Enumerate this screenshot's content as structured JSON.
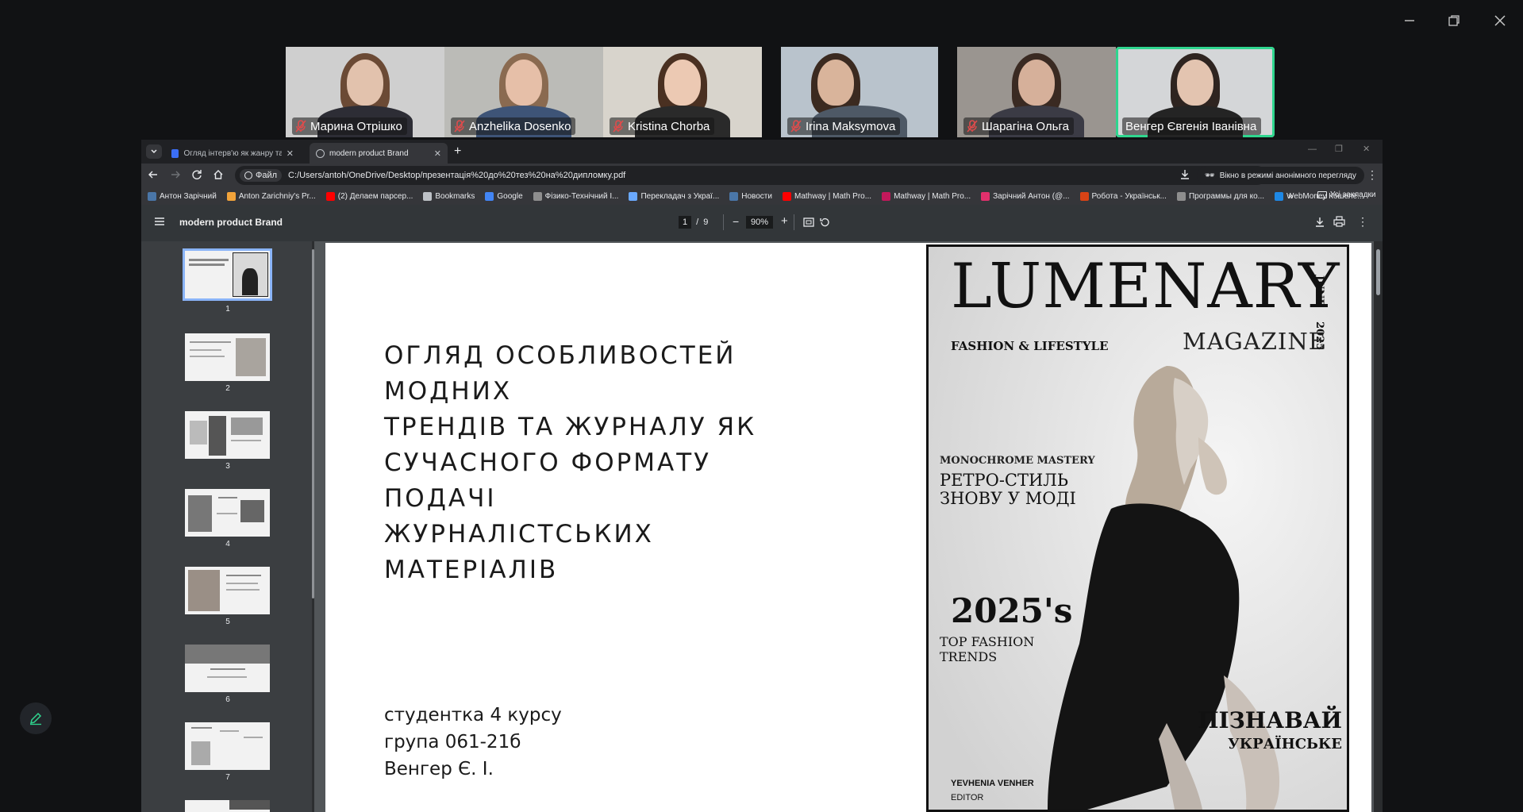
{
  "participants": [
    {
      "name": "Марина Отрішко",
      "muted": true
    },
    {
      "name": "Anzhelika Dosenko",
      "muted": true
    },
    {
      "name": "Kristina Chorba",
      "muted": true
    },
    {
      "name": "Irina Maksymova",
      "muted": true
    },
    {
      "name": "Шарагіна Ольга",
      "muted": true
    },
    {
      "name": "Венгер Євгенія Іванівна",
      "muted": false,
      "active": true
    }
  ],
  "browser": {
    "tabs": [
      {
        "label": "Огляд інтерв'ю як жанру та м..."
      },
      {
        "label": "modern product Brand",
        "active": true
      }
    ],
    "address": {
      "scheme_label": "Файл",
      "url": "C:/Users/antoh/OneDrive/Desktop/презентація%20до%20тез%20на%20дипломку.pdf"
    },
    "incognito_label": "Вікно в режимі анонімного перегляду",
    "bookmarks": [
      {
        "label": "Антон Зарічний",
        "color": "#4a76a8"
      },
      {
        "label": "Anton Zarichniy's Pr...",
        "color": "#f2a33a"
      },
      {
        "label": "(2) Делаем парсер...",
        "color": "#ff0000"
      },
      {
        "label": "Bookmarks",
        "color": "#bdc1c6"
      },
      {
        "label": "Google",
        "color": "#4285f4"
      },
      {
        "label": "Фізико-Технічний І...",
        "color": "#8e8e8e"
      },
      {
        "label": "Перекладач з Украї...",
        "color": "#6aa9ff"
      },
      {
        "label": "Новости",
        "color": "#4a76a8"
      },
      {
        "label": "Mathway | Math Pro...",
        "color": "#ff0000"
      },
      {
        "label": "Mathway | Math Pro...",
        "color": "#c2185b"
      },
      {
        "label": "Зарічний Антон (@...",
        "color": "#e1306c"
      },
      {
        "label": "Робота - Українськ...",
        "color": "#d84315"
      },
      {
        "label": "Программы для ко...",
        "color": "#8e8e8e"
      },
      {
        "label": "WebMoney Кошелё...",
        "color": "#1e88e5"
      }
    ],
    "all_bookmarks_label": "Усі закладки"
  },
  "pdf": {
    "title": "modern product Brand",
    "current_page": "1",
    "total_pages": "9",
    "zoom": "90%",
    "thumbnails": [
      "1",
      "2",
      "3",
      "4",
      "5",
      "6",
      "7"
    ]
  },
  "slide": {
    "title_lines": [
      "ОГЛЯД ОСОБЛИВОСТЕЙ МОДНИХ",
      "ТРЕНДІВ ТА ЖУРНАЛУ ЯК",
      "СУЧАСНОГО ФОРМАТУ ПОДАЧІ",
      "ЖУРНАЛІСТСЬКИХ МАТЕРІАЛІВ"
    ],
    "meta_lines": [
      "студентка 4 курсу",
      "група 061-21б",
      "Венгер Є. І."
    ]
  },
  "cover": {
    "masthead": "LUMENARY",
    "month": "JUNE",
    "year": "2025",
    "magazine": "MAGAZINE",
    "tagline": "FASHION & LIFESTYLE",
    "kicker": "MONOCHROME MASTERY",
    "headline_1": "РЕТРО-СТИЛЬ",
    "headline_2": "ЗНОВУ У МОДІ",
    "big_year": "2025's",
    "trends_1": "TOP FASHION",
    "trends_2": "TRENDS",
    "promo_1": "ПІЗНАВАЙ",
    "promo_2": "УКРАЇНСЬКЕ",
    "editor_name": "YEVHENIA VENHER",
    "editor_role": "EDITOR"
  }
}
